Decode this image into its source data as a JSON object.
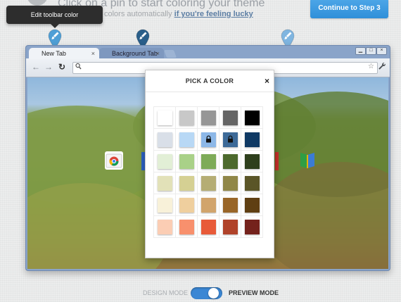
{
  "header": {
    "instruction_title": "Click on a pin to start coloring your theme",
    "instruction_sub_prefix": "colors automatically ",
    "instruction_sub_link": "if you're feeling lucky",
    "tooltip": "Edit toolbar color",
    "continue_label": "Continue to Step 3"
  },
  "pins": [
    {
      "name": "toolbar",
      "icon": "paint-brush-icon",
      "color": "#4f9fd6"
    },
    {
      "name": "background-tab",
      "icon": "paint-brush-icon",
      "color": "#2b5f8a"
    },
    {
      "name": "frame",
      "icon": "paint-brush-icon",
      "color": "#7fb5e0"
    }
  ],
  "browser": {
    "tabs": [
      {
        "label": "New Tab",
        "close": "×"
      },
      {
        "label": "Background Tab",
        "close": "×"
      }
    ],
    "window_controls": [
      "▁",
      "□",
      "×"
    ],
    "nav": {
      "back": "←",
      "forward": "→",
      "reload": "↻",
      "star": "☆",
      "wrench": "🔧"
    }
  },
  "picker": {
    "title": "PICK A COLOR",
    "close": "×",
    "rows": [
      [
        {
          "color": "#ffffff"
        },
        {
          "color": "#c8c8c8"
        },
        {
          "color": "#969696"
        },
        {
          "color": "#666666"
        },
        {
          "color": "#000000"
        }
      ],
      [
        {
          "color": "#d9dfe8"
        },
        {
          "color": "#b8d8f5"
        },
        {
          "color": "#8db8e8",
          "locked": true
        },
        {
          "color": "#3d6a98",
          "locked": true
        },
        {
          "color": "#0f3964"
        }
      ],
      [
        {
          "color": "#e2efd6"
        },
        {
          "color": "#a9d188"
        },
        {
          "color": "#7eab58"
        },
        {
          "color": "#4d6a2d"
        },
        {
          "color": "#2e3f1c"
        }
      ],
      [
        {
          "color": "#e2e1b8"
        },
        {
          "color": "#d5d093"
        },
        {
          "color": "#b5ad74"
        },
        {
          "color": "#908748"
        },
        {
          "color": "#5a5527"
        }
      ],
      [
        {
          "color": "#f8f1d9"
        },
        {
          "color": "#efcf9e"
        },
        {
          "color": "#d1a46c"
        },
        {
          "color": "#996628"
        },
        {
          "color": "#5f3f12"
        }
      ],
      [
        {
          "color": "#fbcdb4"
        },
        {
          "color": "#f8906d"
        },
        {
          "color": "#e85a38"
        },
        {
          "color": "#b0432a"
        },
        {
          "color": "#74221c"
        }
      ]
    ]
  },
  "mode": {
    "design_label": "DESIGN MODE",
    "preview_label": "PREVIEW MODE",
    "state": "preview"
  }
}
